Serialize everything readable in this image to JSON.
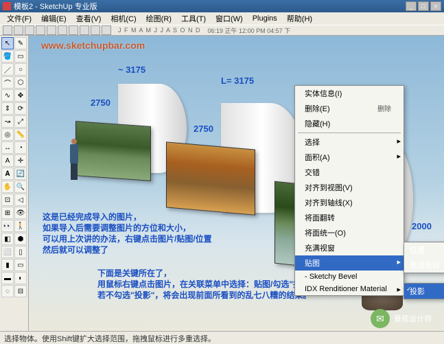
{
  "title": "模板2 - SketchUp 专业版",
  "menus": [
    "文件(F)",
    "编辑(E)",
    "查看(V)",
    "相机(C)",
    "绘图(R)",
    "工具(T)",
    "窗口(W)",
    "Plugins",
    "帮助(H)"
  ],
  "months": "J F M A M J J A S O N D",
  "time": "06:19 正午  12:00 PM  04:57 下",
  "watermark": "www.sketchupbar.com",
  "dims": {
    "tilde": "~ 3175",
    "l": "L= 3175",
    "a": "2750",
    "b": "2750",
    "c": "2000",
    "d": "2000"
  },
  "ctx": {
    "info": "实体信息(I)",
    "del": "删除(E)",
    "delKey": "删除",
    "hide": "隐藏(H)",
    "select": "选择",
    "area": "面积(A)",
    "intersect": "交错",
    "alignView": "对齐到视图(V)",
    "alignAxis": "对齐到轴线(X)",
    "flip": "将面翻转",
    "unify": "将面统一(O)",
    "zoom": "充满视窗",
    "tex": "贴图",
    "bevel": "- Sketchy Bevel",
    "idx": "IDX Renditioner Material"
  },
  "sub1": {
    "pos": "位置",
    "reset": "重设坐标"
  },
  "sub2": {
    "proj": "投影"
  },
  "notes": {
    "n1": "这是已经完成导入的图片，\n如果导入后需要调整图片的方位和大小，\n可以用上次讲的办法，右键点击图片/贴图/位置\n然后就可以调整了",
    "n2": "下面是关键所在了，\n用鼠标右键点击图片，在关联菜单中选择：贴图/勾选\"投影\"（见图示）\n若不勾选\"投影\"，将会出现前面所看到的乱七八糟的结果。"
  },
  "wechat": "景观设计师",
  "status": "选择物体。使用Shift键扩大选择范围，拖拽鼠标进行多重选择。"
}
